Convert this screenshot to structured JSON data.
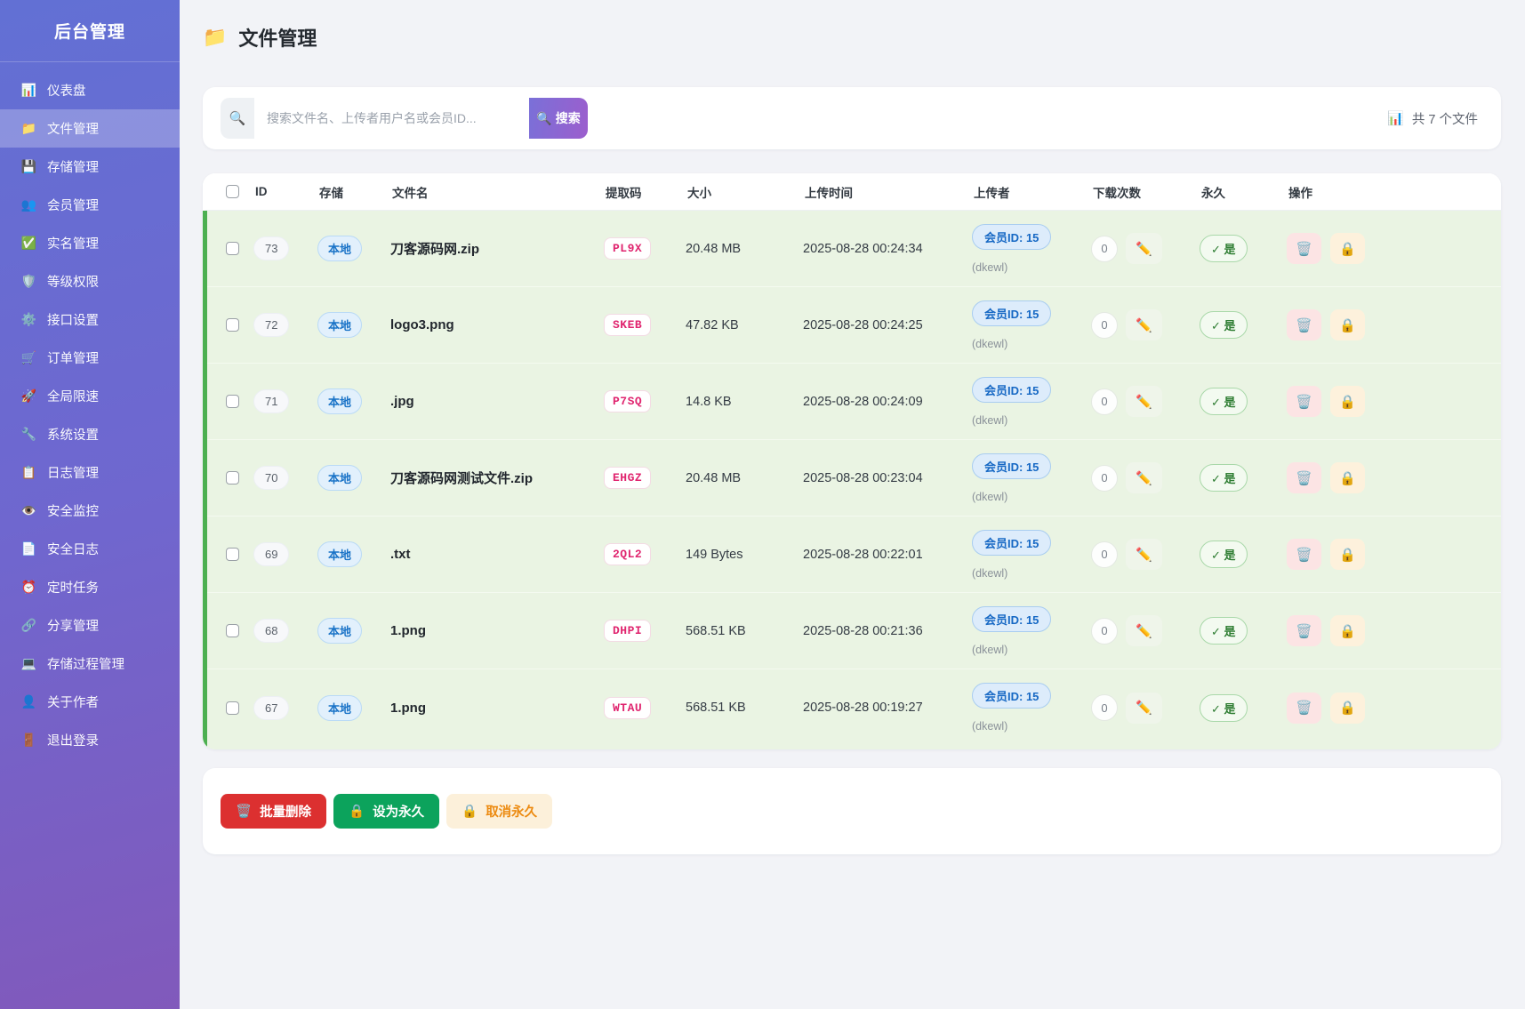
{
  "app": {
    "title": "后台管理"
  },
  "sidebar": {
    "items": [
      {
        "key": "dashboard",
        "icon": "dashboard-chart-icon",
        "glyph": "📊",
        "label": "仪表盘",
        "active": false
      },
      {
        "key": "files",
        "icon": "folder-icon",
        "glyph": "📁",
        "label": "文件管理",
        "active": true
      },
      {
        "key": "storage",
        "icon": "floppy-disk-icon",
        "glyph": "💾",
        "label": "存储管理",
        "active": false
      },
      {
        "key": "members",
        "icon": "users-icon",
        "glyph": "👥",
        "label": "会员管理",
        "active": false
      },
      {
        "key": "realname",
        "icon": "check-box-icon",
        "glyph": "✅",
        "label": "实名管理",
        "active": false
      },
      {
        "key": "levels",
        "icon": "shield-icon",
        "glyph": "🛡️",
        "label": "等级权限",
        "active": false
      },
      {
        "key": "api-settings",
        "icon": "gear-icon",
        "glyph": "⚙️",
        "label": "接口设置",
        "active": false
      },
      {
        "key": "orders",
        "icon": "cart-icon",
        "glyph": "🛒",
        "label": "订单管理",
        "active": false
      },
      {
        "key": "speed-limit",
        "icon": "rocket-icon",
        "glyph": "🚀",
        "label": "全局限速",
        "active": false
      },
      {
        "key": "system-settings",
        "icon": "wrench-icon",
        "glyph": "🔧",
        "label": "系统设置",
        "active": false
      },
      {
        "key": "log-management",
        "icon": "clipboard-icon",
        "glyph": "📋",
        "label": "日志管理",
        "active": false
      },
      {
        "key": "security-monitor",
        "icon": "eye-icon",
        "glyph": "👁️",
        "label": "安全监控",
        "active": false
      },
      {
        "key": "security-logs",
        "icon": "document-icon",
        "glyph": "📄",
        "label": "安全日志",
        "active": false
      },
      {
        "key": "cron-tasks",
        "icon": "alarm-clock-icon",
        "glyph": "⏰",
        "label": "定时任务",
        "active": false
      },
      {
        "key": "share-management",
        "icon": "link-icon",
        "glyph": "🔗",
        "label": "分享管理",
        "active": false
      },
      {
        "key": "stored-procedures",
        "icon": "computer-icon",
        "glyph": "💻",
        "label": "存储过程管理",
        "active": false
      },
      {
        "key": "about-author",
        "icon": "person-icon",
        "glyph": "👤",
        "label": "关于作者",
        "active": false
      },
      {
        "key": "logout",
        "icon": "door-icon",
        "glyph": "🚪",
        "label": "退出登录",
        "active": false
      }
    ]
  },
  "page": {
    "title": "文件管理",
    "title_icon": "📁"
  },
  "search": {
    "icon": "🔍",
    "placeholder": "搜索文件名、上传者用户名或会员ID...",
    "button_icon": "🔍",
    "button_label": "搜索",
    "count_icon": "📊",
    "count_text": "共 7 个文件"
  },
  "table": {
    "headers": [
      "ID",
      "存储",
      "文件名",
      "提取码",
      "大小",
      "上传时间",
      "上传者",
      "下载次数",
      "永久",
      "操作"
    ],
    "rows": [
      {
        "id": "73",
        "storage": "本地",
        "filename": "刀客源码网.zip",
        "code": "PL9X",
        "size": "20.48 MB",
        "time": "2025-08-28 00:24:34",
        "uploader_id": "会员ID: 15",
        "uploader_name": "(dkewl)",
        "downloads": "0",
        "permanent": "✓ 是"
      },
      {
        "id": "72",
        "storage": "本地",
        "filename": "logo3.png",
        "code": "SKEB",
        "size": "47.82 KB",
        "time": "2025-08-28 00:24:25",
        "uploader_id": "会员ID: 15",
        "uploader_name": "(dkewl)",
        "downloads": "0",
        "permanent": "✓ 是"
      },
      {
        "id": "71",
        "storage": "本地",
        "filename": ".jpg",
        "code": "P7SQ",
        "size": "14.8 KB",
        "time": "2025-08-28 00:24:09",
        "uploader_id": "会员ID: 15",
        "uploader_name": "(dkewl)",
        "downloads": "0",
        "permanent": "✓ 是"
      },
      {
        "id": "70",
        "storage": "本地",
        "filename": "刀客源码网测试文件.zip",
        "code": "EHGZ",
        "size": "20.48 MB",
        "time": "2025-08-28 00:23:04",
        "uploader_id": "会员ID: 15",
        "uploader_name": "(dkewl)",
        "downloads": "0",
        "permanent": "✓ 是"
      },
      {
        "id": "69",
        "storage": "本地",
        "filename": ".txt",
        "code": "2QL2",
        "size": "149 Bytes",
        "time": "2025-08-28 00:22:01",
        "uploader_id": "会员ID: 15",
        "uploader_name": "(dkewl)",
        "downloads": "0",
        "permanent": "✓ 是"
      },
      {
        "id": "68",
        "storage": "本地",
        "filename": "1.png",
        "code": "DHPI",
        "size": "568.51 KB",
        "time": "2025-08-28 00:21:36",
        "uploader_id": "会员ID: 15",
        "uploader_name": "(dkewl)",
        "downloads": "0",
        "permanent": "✓ 是"
      },
      {
        "id": "67",
        "storage": "本地",
        "filename": "1.png",
        "code": "WTAU",
        "size": "568.51 KB",
        "time": "2025-08-28 00:19:27",
        "uploader_id": "会员ID: 15",
        "uploader_name": "(dkewl)",
        "downloads": "0",
        "permanent": "✓ 是"
      }
    ],
    "row_icons": {
      "edit": "✏️",
      "trash": "🗑️",
      "lock": "🔒"
    }
  },
  "actions": {
    "batch_delete": {
      "icon": "🗑️",
      "label": "批量删除"
    },
    "set_permanent": {
      "icon": "🔒",
      "label": "设为永久"
    },
    "cancel_permanent": {
      "icon": "🔒",
      "label": "取消永久"
    }
  },
  "colors": {
    "sidebar_top": "#6270d4",
    "sidebar_bottom": "#8159bb",
    "row_accent_green": "#4caf50",
    "row_background": "#eaf4e3",
    "storage_blue": "#1a73c7",
    "code_pink": "#e0256f",
    "permanent_green": "#2e7d32",
    "delete_red": "#dc3030",
    "set_permanent_green": "#0ca35c",
    "cancel_orange": "#ec8a10"
  }
}
